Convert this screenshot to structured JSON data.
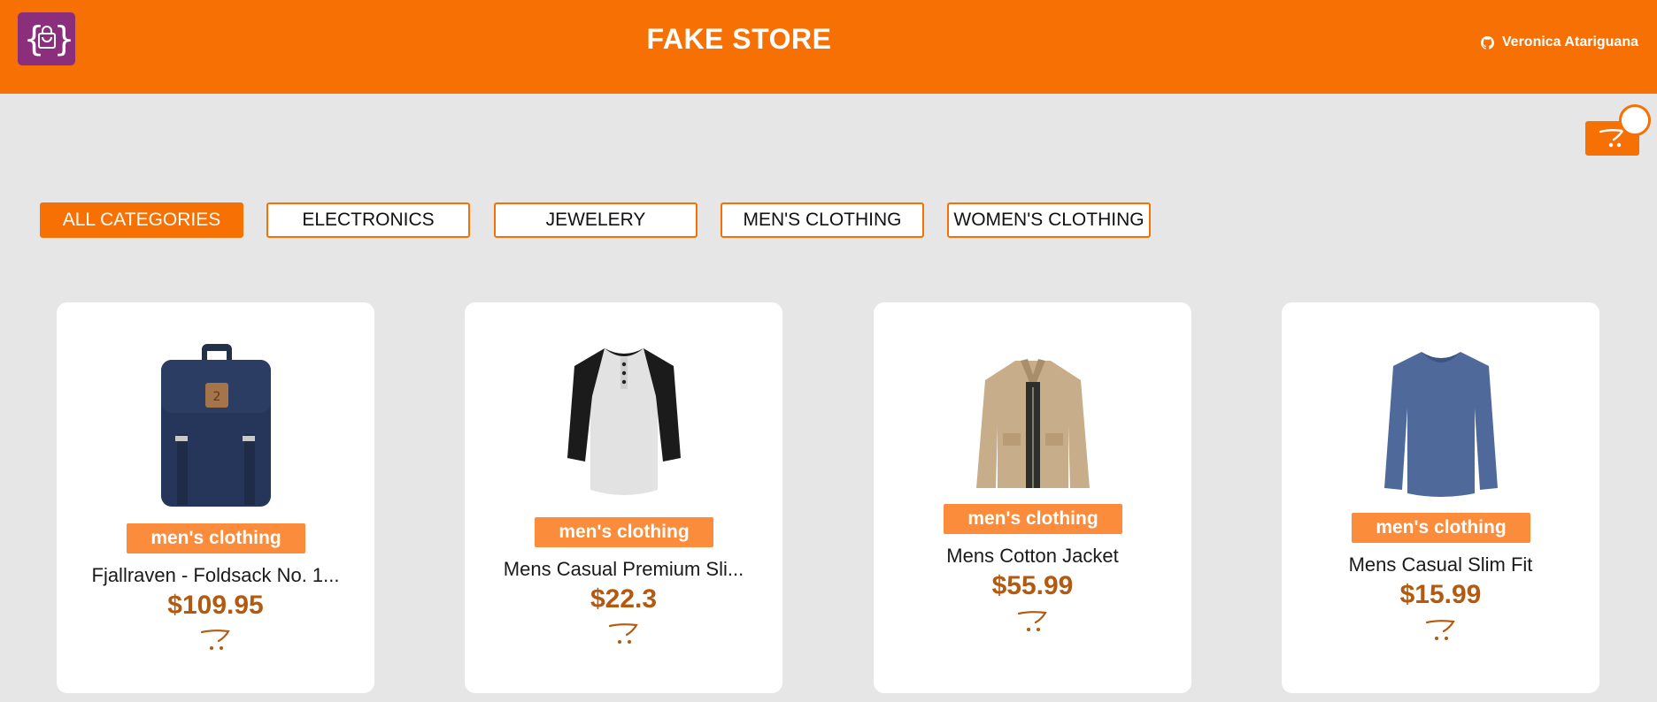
{
  "header": {
    "title": "FAKE STORE",
    "user_name": "Veronica Atariguana",
    "brand_color": "#f77004",
    "logo_color": "#8b2f7c"
  },
  "cart": {
    "icon": "cart-icon"
  },
  "categories": [
    {
      "label": "ALL CATEGORIES",
      "active": true
    },
    {
      "label": "ELECTRONICS",
      "active": false
    },
    {
      "label": "JEWELERY",
      "active": false
    },
    {
      "label": "MEN'S CLOTHING",
      "active": false
    },
    {
      "label": "WOMEN'S CLOTHING",
      "active": false
    }
  ],
  "products": [
    {
      "category": "men's clothing",
      "name": "Fjallraven - Foldsack No. 1...",
      "price": "$109.95",
      "image": "backpack-image"
    },
    {
      "category": "men's clothing",
      "name": "Mens Casual Premium Sli...",
      "price": "$22.3",
      "image": "raglan-shirt-image"
    },
    {
      "category": "men's clothing",
      "name": "Mens Cotton Jacket",
      "price": "$55.99",
      "image": "jacket-image"
    },
    {
      "category": "men's clothing",
      "name": "Mens Casual Slim Fit",
      "price": "$15.99",
      "image": "longsleeve-shirt-image"
    }
  ]
}
